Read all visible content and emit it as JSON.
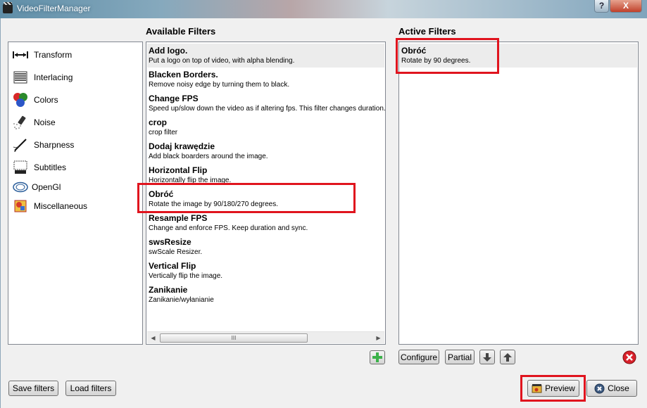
{
  "window": {
    "title": "VideoFilterManager"
  },
  "titlebar": {
    "help_label": "?",
    "close_label": "X"
  },
  "sections": {
    "available": "Available Filters",
    "active": "Active Filters"
  },
  "categories": [
    {
      "label": "Transform",
      "icon": "transform-icon"
    },
    {
      "label": "Interlacing",
      "icon": "interlacing-icon"
    },
    {
      "label": "Colors",
      "icon": "colors-icon"
    },
    {
      "label": "Noise",
      "icon": "noise-icon"
    },
    {
      "label": "Sharpness",
      "icon": "sharpness-icon"
    },
    {
      "label": "Subtitles",
      "icon": "subtitles-icon"
    },
    {
      "label": "OpenGl",
      "icon": "opengl-icon"
    },
    {
      "label": "Miscellaneous",
      "icon": "miscellaneous-icon"
    }
  ],
  "available_filters": [
    {
      "name": "Add logo.",
      "desc": "Put a logo on top of video, with alpha blending."
    },
    {
      "name": "Blacken Borders.",
      "desc": "Remove noisy edge by turning them to black."
    },
    {
      "name": "Change FPS",
      "desc": "Speed up/slow down the video as if altering fps. This filter changes duration."
    },
    {
      "name": "crop",
      "desc": "crop filter"
    },
    {
      "name": "Dodaj krawędzie",
      "desc": "Add black boarders around the image."
    },
    {
      "name": "Horizontal Flip",
      "desc": "Horizontally flip the image."
    },
    {
      "name": "Obróć",
      "desc": "Rotate the image by 90/180/270 degrees."
    },
    {
      "name": "Resample FPS",
      "desc": "Change and enforce FPS. Keep duration and sync."
    },
    {
      "name": "swsResize",
      "desc": "swScale Resizer."
    },
    {
      "name": "Vertical Flip",
      "desc": "Vertically flip the image."
    },
    {
      "name": "Zanikanie",
      "desc": "Zanikanie/wyłanianie"
    }
  ],
  "active_filters": [
    {
      "name": "Obróć",
      "desc": "Rotate by 90 degrees."
    }
  ],
  "scrollbar": {
    "thumb_grip": "III",
    "left_arrow": "◀",
    "right_arrow": "▶"
  },
  "buttons": {
    "configure": "Configure",
    "partial": "Partial",
    "save_filters": "Save filters",
    "load_filters": "Load filters",
    "preview": "Preview",
    "close": "Close"
  },
  "colors": {
    "highlight_red": "#e0141e",
    "add_green": "#3cb24a",
    "remove_red": "#d8202a"
  }
}
